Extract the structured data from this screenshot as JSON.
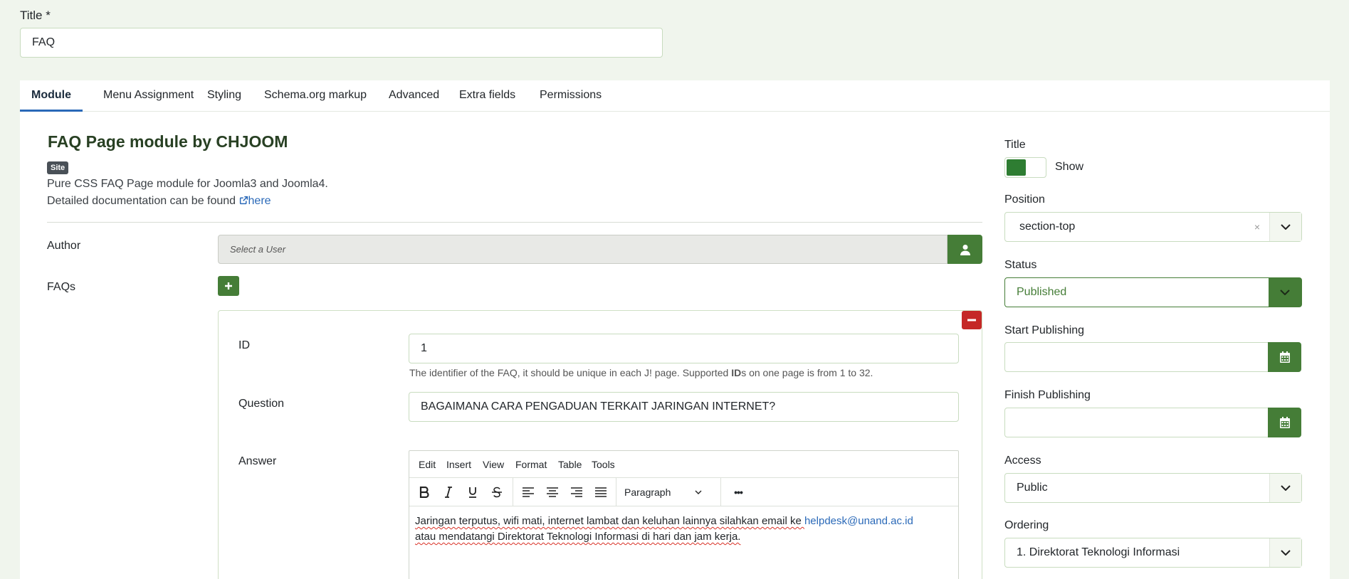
{
  "header": {
    "title_label": "Title *",
    "title_value": "FAQ"
  },
  "tabs": [
    {
      "label": "Module"
    },
    {
      "label": "Menu Assignment"
    },
    {
      "label": "Styling"
    },
    {
      "label": "Schema.org markup"
    },
    {
      "label": "Advanced"
    },
    {
      "label": "Extra fields"
    },
    {
      "label": "Permissions"
    }
  ],
  "module": {
    "title": "FAQ Page module by CHJOOM",
    "badge": "Site",
    "description": "Pure CSS FAQ Page module for Joomla3 and Joomla4.",
    "doc_text": "Detailed documentation can be found",
    "doc_link": "here"
  },
  "author": {
    "label": "Author",
    "placeholder": "Select a User"
  },
  "faqs": {
    "label": "FAQs",
    "id_label": "ID",
    "id_value": "1",
    "id_help_prefix": "The identifier of the FAQ, it should be unique in each J! page. Supported ",
    "id_help_bold": "ID",
    "id_help_suffix": "s on one page is from 1 to 32.",
    "question_label": "Question",
    "question_value": "BAGAIMANA CARA PENGADUAN TERKAIT JARINGAN INTERNET?",
    "answer_label": "Answer"
  },
  "editor": {
    "menus": [
      "Edit",
      "Insert",
      "View",
      "Format",
      "Table",
      "Tools"
    ],
    "paragraph": "Paragraph",
    "more": "•••",
    "body_line1": "Jaringan terputus, wifi mati, internet lambat dan keluhan lainnya silahkan email ke ",
    "body_link": "helpdesk@unand.ac.id",
    "body_line2": "atau mendatangi Direktorat Teknologi Informasi di hari dan jam kerja."
  },
  "sidebar": {
    "title_label": "Title",
    "title_toggle": "Show",
    "position_label": "Position",
    "position_value": "section-top",
    "status_label": "Status",
    "status_value": "Published",
    "start_label": "Start Publishing",
    "finish_label": "Finish Publishing",
    "access_label": "Access",
    "access_value": "Public",
    "ordering_label": "Ordering",
    "ordering_value": "1. Direktorat Teknologi Informasi"
  },
  "colors": {
    "accent": "#457d37",
    "danger": "#c52827",
    "link": "#2a69b8",
    "tab_active": "#2a69b8"
  }
}
